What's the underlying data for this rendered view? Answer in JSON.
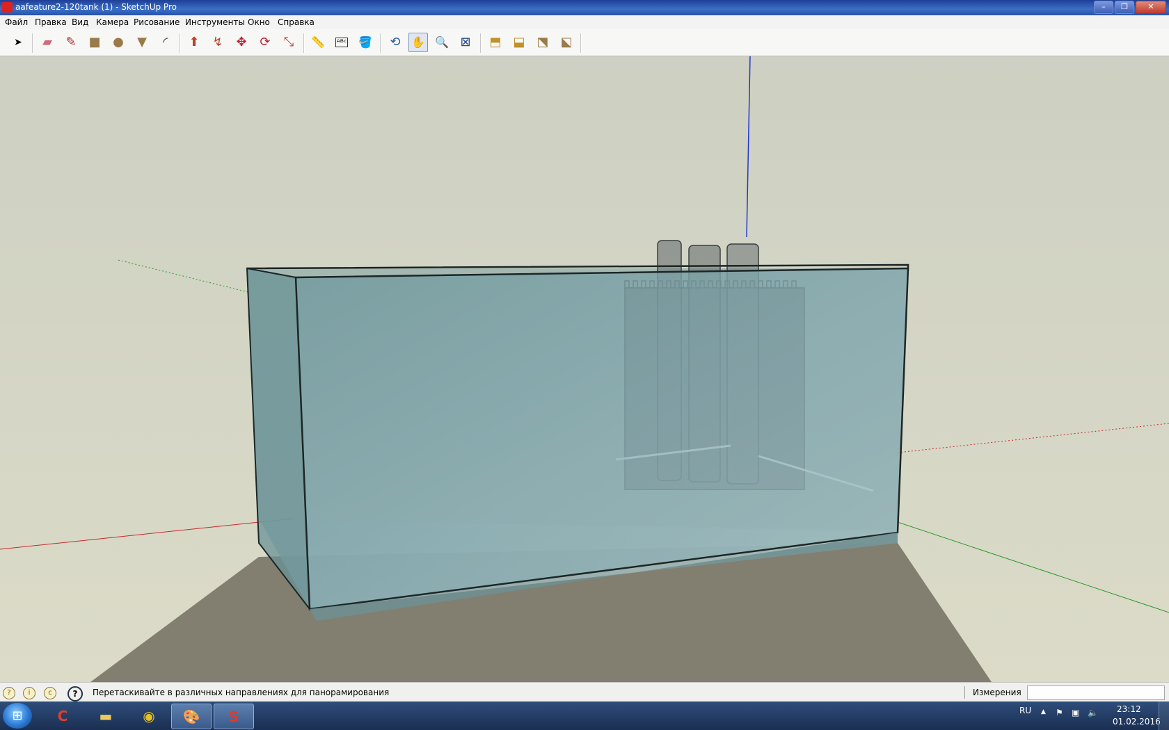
{
  "window": {
    "title": "aafeature2-120tank (1) - SketchUp Pro",
    "minimize": "–",
    "maximize": "❐",
    "close": "✕"
  },
  "menu": [
    "Файл",
    "Правка",
    "Вид",
    "Камера",
    "Рисование",
    "Инструменты",
    "Окно",
    "Справка"
  ],
  "toolbar": {
    "tools": [
      {
        "name": "select-tool",
        "icon": "arrow-cursor-icon",
        "glyph": "➤"
      },
      {
        "name": "eraser-tool",
        "icon": "eraser-icon",
        "glyph": "▰"
      },
      {
        "name": "pencil-tool",
        "icon": "pencil-icon",
        "glyph": "✎"
      },
      {
        "name": "rectangle-tool",
        "icon": "rectangle-icon",
        "glyph": "■"
      },
      {
        "name": "circle-tool",
        "icon": "circle-icon",
        "glyph": "●"
      },
      {
        "name": "polygon-tool",
        "icon": "polygon-icon",
        "glyph": "▼"
      },
      {
        "name": "arc-tool",
        "icon": "arc-icon",
        "glyph": "◜"
      },
      {
        "name": "push-pull-tool",
        "icon": "push-pull-icon",
        "glyph": "⬆"
      },
      {
        "name": "follow-me-tool",
        "icon": "follow-me-icon",
        "glyph": "↯"
      },
      {
        "name": "move-tool",
        "icon": "move-icon",
        "glyph": "✥"
      },
      {
        "name": "rotate-tool",
        "icon": "rotate-icon",
        "glyph": "⟳"
      },
      {
        "name": "scale-tool",
        "icon": "scale-icon",
        "glyph": "⤡"
      },
      {
        "name": "tape-measure-tool",
        "icon": "tape-measure-icon",
        "glyph": "📏"
      },
      {
        "name": "text-tool",
        "icon": "text-label-icon",
        "glyph": "ᴬᴮᶜ"
      },
      {
        "name": "paint-bucket-tool",
        "icon": "paint-bucket-icon",
        "glyph": "🪣"
      },
      {
        "name": "orbit-tool",
        "icon": "orbit-icon",
        "glyph": "⟲"
      },
      {
        "name": "pan-tool",
        "icon": "hand-icon",
        "glyph": "✋",
        "active": true
      },
      {
        "name": "zoom-tool",
        "icon": "magnifier-icon",
        "glyph": "🔍"
      },
      {
        "name": "zoom-extents-tool",
        "icon": "zoom-extents-icon",
        "glyph": "⊠"
      },
      {
        "name": "warehouse-get-models",
        "icon": "warehouse-icon",
        "glyph": "⬒"
      },
      {
        "name": "warehouse-share-model",
        "icon": "share-model-icon",
        "glyph": "⬓"
      },
      {
        "name": "extension-warehouse",
        "icon": "extension-warehouse-icon",
        "glyph": "⬔"
      },
      {
        "name": "share-component",
        "icon": "share-component-icon",
        "glyph": "⬕"
      }
    ]
  },
  "status": {
    "hint": "Перетаскивайте в различных направлениях для панорамирования",
    "measurements_label": "Измерения",
    "measurements_value": ""
  },
  "taskbar": {
    "apps": [
      "ccleaner-icon",
      "file-explorer-icon",
      "chrome-icon",
      "paint-icon",
      "sketchup-icon"
    ],
    "lang": "RU",
    "time": "23:12",
    "date": "01.02.2016"
  },
  "colors": {
    "sky": "#d2d3c2",
    "ground": "#827f71",
    "glass": "#7fa6ac",
    "axis_red": "#c8282a",
    "axis_green": "#2a9a2a",
    "axis_blue": "#2436c8"
  }
}
